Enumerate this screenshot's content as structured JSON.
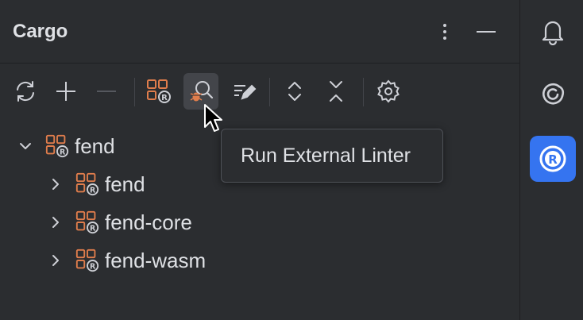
{
  "panel": {
    "title": "Cargo",
    "header_icons": [
      "more-vertical-icon",
      "minimize-icon"
    ]
  },
  "toolbar": {
    "buttons": [
      "refresh-icon",
      "add-icon",
      "remove-icon",
      "cargo-modules-icon",
      "run-external-linter-icon",
      "edit-config-icon",
      "expand-all-icon",
      "collapse-all-icon",
      "settings-icon"
    ]
  },
  "tree": {
    "root": {
      "label": "fend",
      "expanded": true
    },
    "children": [
      {
        "label": "fend",
        "expanded": false
      },
      {
        "label": "fend-core",
        "expanded": false
      },
      {
        "label": "fend-wasm",
        "expanded": false
      }
    ]
  },
  "tooltip": {
    "text": "Run External Linter"
  },
  "sidebar": {
    "items": [
      "notifications-icon",
      "ai-assistant-icon",
      "rust-cargo-icon"
    ],
    "active": "rust-cargo-icon"
  },
  "colors": {
    "background": "#2b2d30",
    "text": "#dfe1e5",
    "accent": "#3574f0",
    "module_icon": "#e07d4c"
  }
}
